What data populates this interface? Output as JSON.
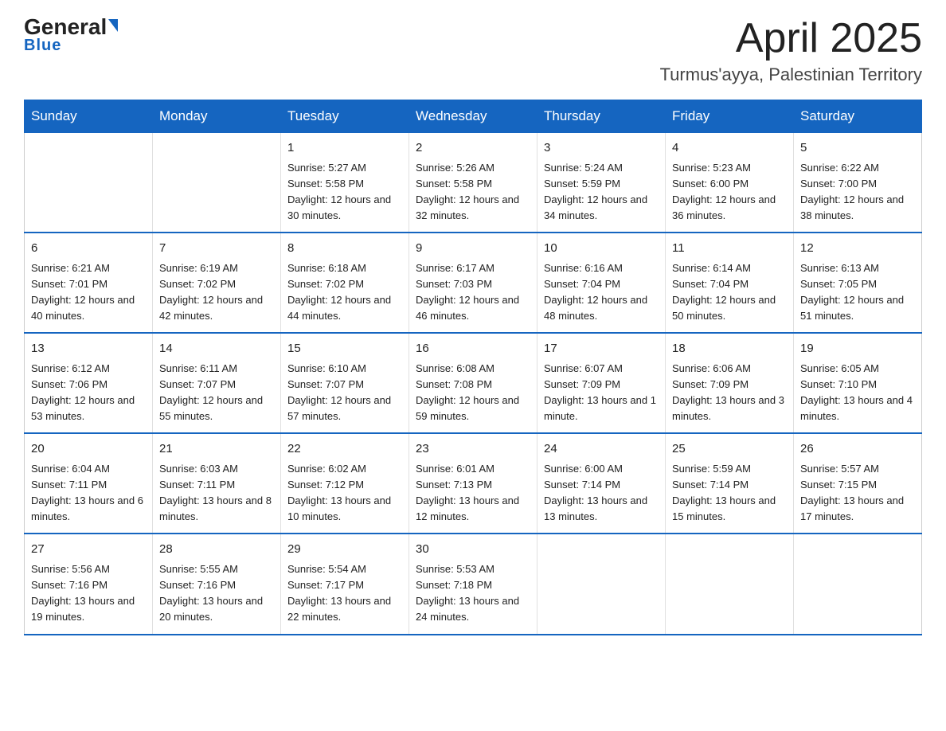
{
  "header": {
    "logo_general": "General",
    "logo_blue": "Blue",
    "title": "April 2025",
    "subtitle": "Turmus'ayya, Palestinian Territory"
  },
  "weekdays": [
    "Sunday",
    "Monday",
    "Tuesday",
    "Wednesday",
    "Thursday",
    "Friday",
    "Saturday"
  ],
  "weeks": [
    [
      {
        "day": "",
        "info": ""
      },
      {
        "day": "",
        "info": ""
      },
      {
        "day": "1",
        "info": "Sunrise: 5:27 AM\nSunset: 5:58 PM\nDaylight: 12 hours\nand 30 minutes."
      },
      {
        "day": "2",
        "info": "Sunrise: 5:26 AM\nSunset: 5:58 PM\nDaylight: 12 hours\nand 32 minutes."
      },
      {
        "day": "3",
        "info": "Sunrise: 5:24 AM\nSunset: 5:59 PM\nDaylight: 12 hours\nand 34 minutes."
      },
      {
        "day": "4",
        "info": "Sunrise: 5:23 AM\nSunset: 6:00 PM\nDaylight: 12 hours\nand 36 minutes."
      },
      {
        "day": "5",
        "info": "Sunrise: 6:22 AM\nSunset: 7:00 PM\nDaylight: 12 hours\nand 38 minutes."
      }
    ],
    [
      {
        "day": "6",
        "info": "Sunrise: 6:21 AM\nSunset: 7:01 PM\nDaylight: 12 hours\nand 40 minutes."
      },
      {
        "day": "7",
        "info": "Sunrise: 6:19 AM\nSunset: 7:02 PM\nDaylight: 12 hours\nand 42 minutes."
      },
      {
        "day": "8",
        "info": "Sunrise: 6:18 AM\nSunset: 7:02 PM\nDaylight: 12 hours\nand 44 minutes."
      },
      {
        "day": "9",
        "info": "Sunrise: 6:17 AM\nSunset: 7:03 PM\nDaylight: 12 hours\nand 46 minutes."
      },
      {
        "day": "10",
        "info": "Sunrise: 6:16 AM\nSunset: 7:04 PM\nDaylight: 12 hours\nand 48 minutes."
      },
      {
        "day": "11",
        "info": "Sunrise: 6:14 AM\nSunset: 7:04 PM\nDaylight: 12 hours\nand 50 minutes."
      },
      {
        "day": "12",
        "info": "Sunrise: 6:13 AM\nSunset: 7:05 PM\nDaylight: 12 hours\nand 51 minutes."
      }
    ],
    [
      {
        "day": "13",
        "info": "Sunrise: 6:12 AM\nSunset: 7:06 PM\nDaylight: 12 hours\nand 53 minutes."
      },
      {
        "day": "14",
        "info": "Sunrise: 6:11 AM\nSunset: 7:07 PM\nDaylight: 12 hours\nand 55 minutes."
      },
      {
        "day": "15",
        "info": "Sunrise: 6:10 AM\nSunset: 7:07 PM\nDaylight: 12 hours\nand 57 minutes."
      },
      {
        "day": "16",
        "info": "Sunrise: 6:08 AM\nSunset: 7:08 PM\nDaylight: 12 hours\nand 59 minutes."
      },
      {
        "day": "17",
        "info": "Sunrise: 6:07 AM\nSunset: 7:09 PM\nDaylight: 13 hours\nand 1 minute."
      },
      {
        "day": "18",
        "info": "Sunrise: 6:06 AM\nSunset: 7:09 PM\nDaylight: 13 hours\nand 3 minutes."
      },
      {
        "day": "19",
        "info": "Sunrise: 6:05 AM\nSunset: 7:10 PM\nDaylight: 13 hours\nand 4 minutes."
      }
    ],
    [
      {
        "day": "20",
        "info": "Sunrise: 6:04 AM\nSunset: 7:11 PM\nDaylight: 13 hours\nand 6 minutes."
      },
      {
        "day": "21",
        "info": "Sunrise: 6:03 AM\nSunset: 7:11 PM\nDaylight: 13 hours\nand 8 minutes."
      },
      {
        "day": "22",
        "info": "Sunrise: 6:02 AM\nSunset: 7:12 PM\nDaylight: 13 hours\nand 10 minutes."
      },
      {
        "day": "23",
        "info": "Sunrise: 6:01 AM\nSunset: 7:13 PM\nDaylight: 13 hours\nand 12 minutes."
      },
      {
        "day": "24",
        "info": "Sunrise: 6:00 AM\nSunset: 7:14 PM\nDaylight: 13 hours\nand 13 minutes."
      },
      {
        "day": "25",
        "info": "Sunrise: 5:59 AM\nSunset: 7:14 PM\nDaylight: 13 hours\nand 15 minutes."
      },
      {
        "day": "26",
        "info": "Sunrise: 5:57 AM\nSunset: 7:15 PM\nDaylight: 13 hours\nand 17 minutes."
      }
    ],
    [
      {
        "day": "27",
        "info": "Sunrise: 5:56 AM\nSunset: 7:16 PM\nDaylight: 13 hours\nand 19 minutes."
      },
      {
        "day": "28",
        "info": "Sunrise: 5:55 AM\nSunset: 7:16 PM\nDaylight: 13 hours\nand 20 minutes."
      },
      {
        "day": "29",
        "info": "Sunrise: 5:54 AM\nSunset: 7:17 PM\nDaylight: 13 hours\nand 22 minutes."
      },
      {
        "day": "30",
        "info": "Sunrise: 5:53 AM\nSunset: 7:18 PM\nDaylight: 13 hours\nand 24 minutes."
      },
      {
        "day": "",
        "info": ""
      },
      {
        "day": "",
        "info": ""
      },
      {
        "day": "",
        "info": ""
      }
    ]
  ]
}
